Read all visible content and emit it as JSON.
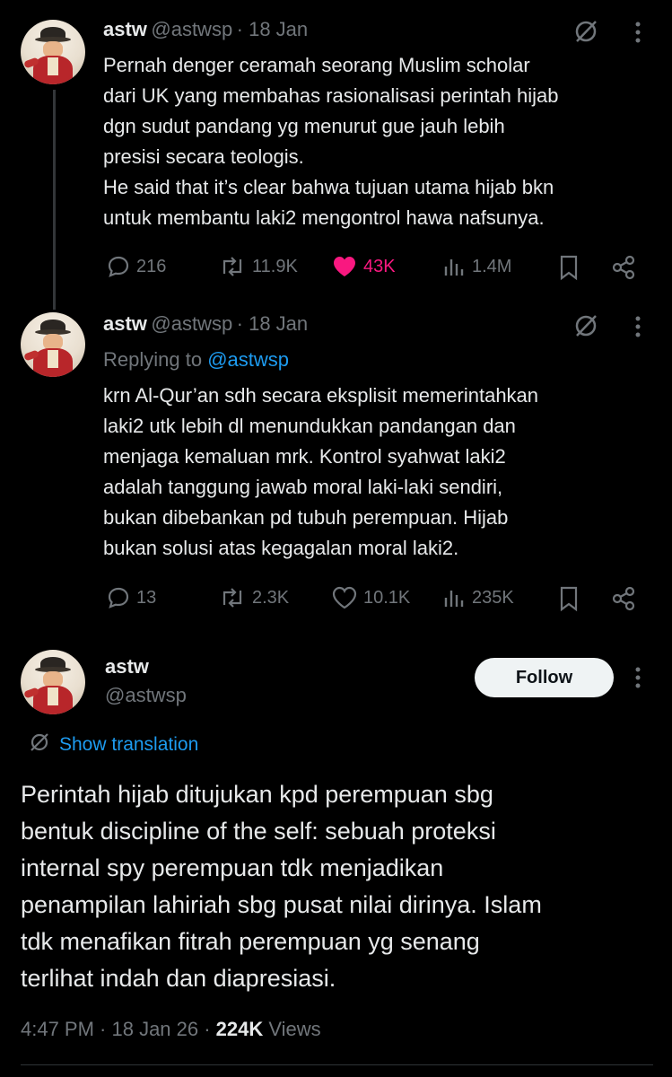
{
  "tweet1": {
    "name": "astw",
    "handle": "@astwsp",
    "date": "· 18 Jan",
    "text": "Pernah denger ceramah seorang Muslim scholar\ndari UK yang membahas rasionalisasi perintah hijab\ndgn sudut pandang yg menurut gue jauh lebih\npresisi secara teologis.\nHe said that it’s clear bahwa tujuan utama hijab bkn\nuntuk membantu laki2 mengontrol hawa nafsunya.",
    "replies": "216",
    "reposts": "11.9K",
    "likes": "43K",
    "views": "1.4M",
    "liked": true
  },
  "tweet2": {
    "name": "astw",
    "handle": "@astwsp",
    "date": "· 18 Jan",
    "replying_prefix": "Replying to ",
    "replying_to": "@astwsp",
    "text": "krn Al-Qur’an sdh secara eksplisit memerintahkan\nlaki2 utk lebih dl menundukkan pandangan dan\nmenjaga kemaluan mrk. Kontrol syahwat laki2\nadalah tanggung jawab moral laki-laki sendiri,\nbukan dibebankan pd tubuh perempuan. Hijab\nbukan solusi atas kegagalan moral laki2.",
    "replies": "13",
    "reposts": "2.3K",
    "likes": "10.1K",
    "views": "235K"
  },
  "main_tweet": {
    "name": "astw",
    "handle": "@astwsp",
    "follow_label": "Follow",
    "show_translation": "Show translation",
    "text": "Perintah hijab ditujukan kpd perempuan sbg\nbentuk discipline of the self: sebuah proteksi\ninternal spy perempuan tdk menjadikan\npenampilan lahiriah sbg pusat nilai dirinya. Islam\ntdk menafikan fitrah perempuan yg senang\nterlihat indah dan diapresiasi.",
    "time": "4:47 PM · 18 Jan 26 · ",
    "views_count": "224K",
    "views_label": " Views"
  },
  "colors": {
    "background": "#000000",
    "text": "#e7e9ea",
    "secondary": "#71767b",
    "link": "#1d9bf0",
    "like": "#f91880"
  },
  "icons": [
    "grok-icon",
    "more-icon",
    "reply-icon",
    "repost-icon",
    "heart-icon",
    "views-icon",
    "bookmark-icon",
    "share-icon",
    "translate-icon"
  ]
}
